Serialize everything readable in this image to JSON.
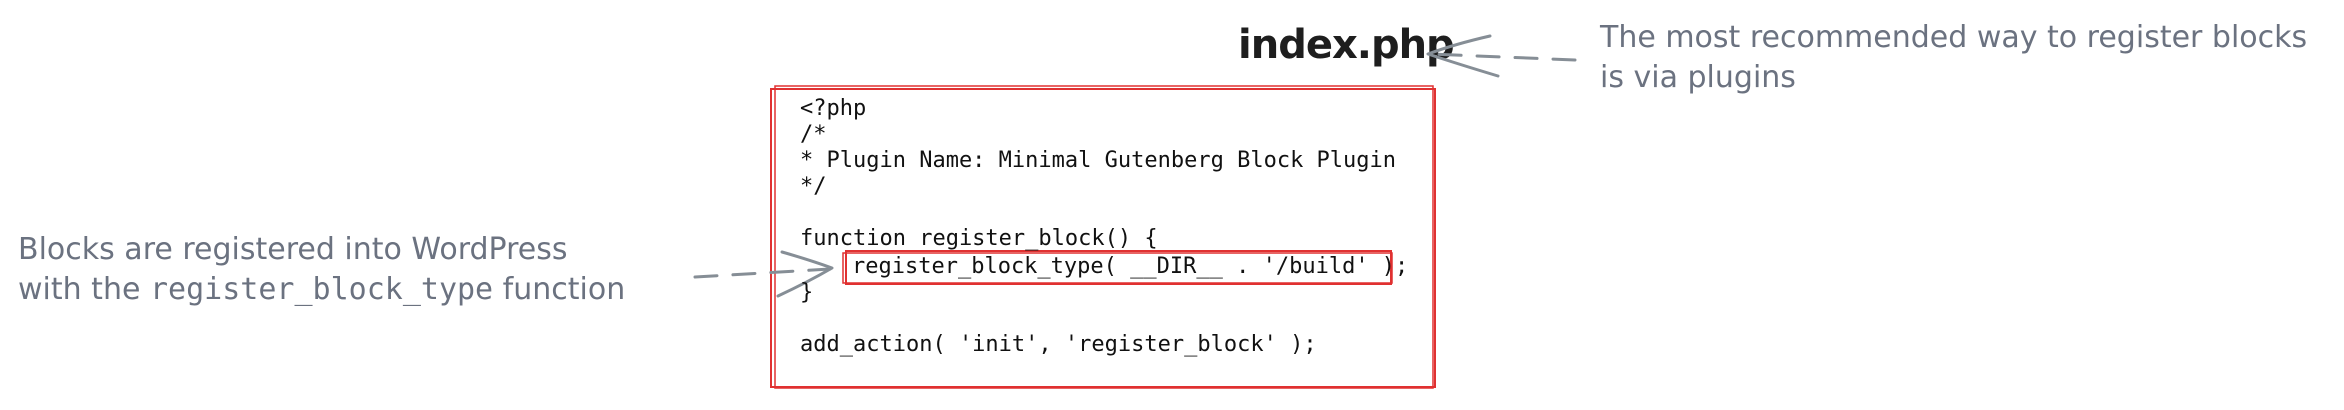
{
  "file": {
    "name": "index.php"
  },
  "annotations": {
    "plugins_note": {
      "line1": "The most recommended way to register blocks",
      "line2": "is via plugins"
    },
    "register_note": {
      "line1": "Blocks are registered into WordPress",
      "line2_prefix": "with the ",
      "line2_code": "register_block_type",
      "line2_suffix": "  function"
    }
  },
  "code": {
    "lines": [
      "<?php",
      "/*",
      "* Plugin Name: Minimal Gutenberg Block Plugin",
      "*/",
      "",
      "function register_block() {",
      "register_block_type( __DIR__ . '/build' );",
      "}",
      "",
      "add_action( 'init', 'register_block' );"
    ]
  },
  "colors": {
    "frame": "#e03131",
    "annotation_text": "#6b7280",
    "arrow": "#868e96",
    "code_text": "#111111"
  }
}
